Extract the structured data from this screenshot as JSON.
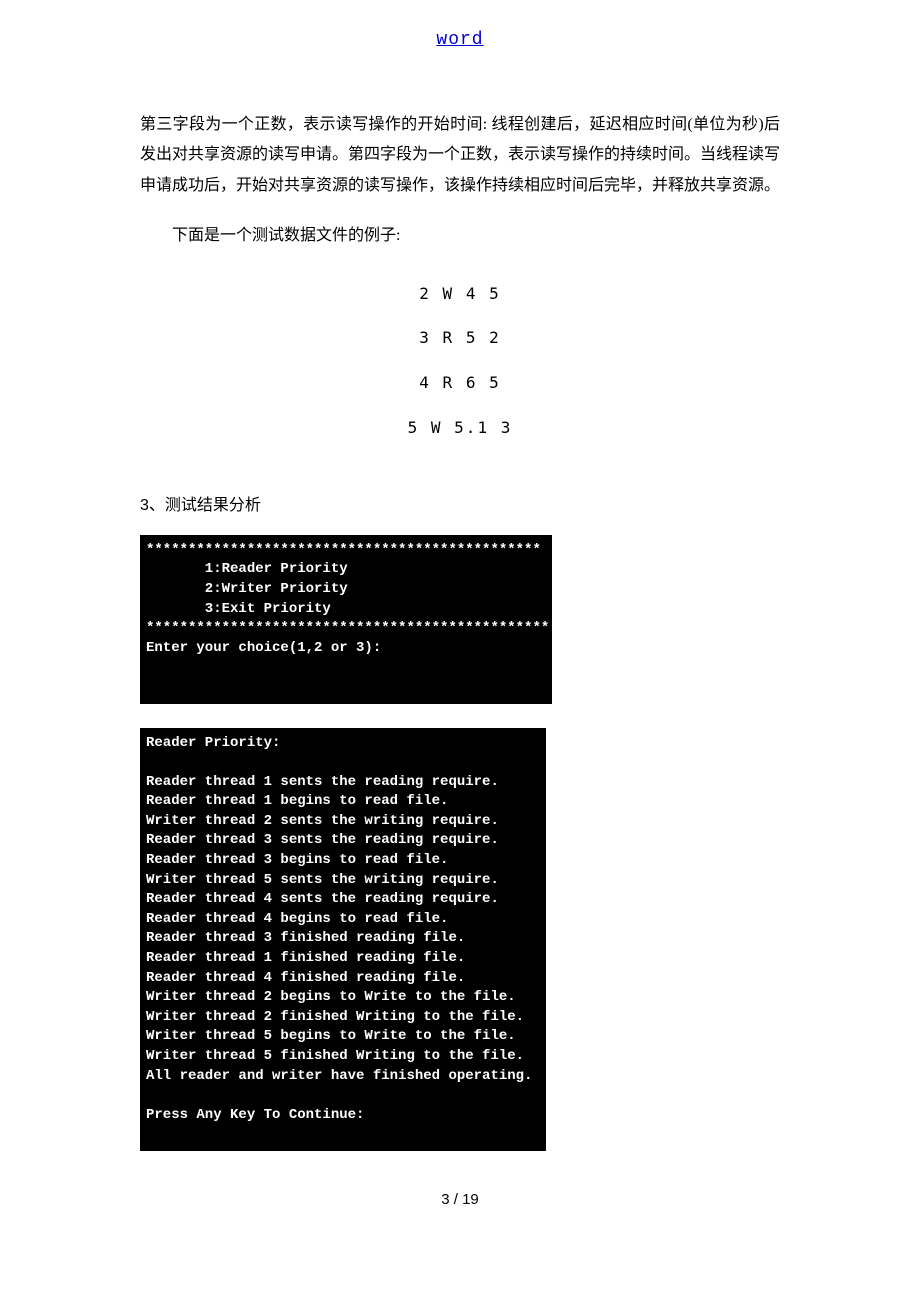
{
  "header": {
    "link": "word"
  },
  "para1": "第三字段为一个正数，表示读写操作的开始时间: 线程创建后，延迟相应时间(单位为秒)后发出对共享资源的读写申请。第四字段为一个正数，表示读写操作的持续时间。当线程读写申请成功后，开始对共享资源的读写操作，该操作持续相应时间后完毕，并释放共享资源。",
  "para2": "下面是一个测试数据文件的例子:",
  "test_data": [
    "2 W 4 5",
    "3 R 5 2",
    "4 R 6 5",
    "5 W 5.1 3"
  ],
  "section3_title": "3、测试结果分析",
  "terminal1": {
    "lines": [
      "***********************************************",
      "       1:Reader Priority",
      "       2:Writer Priority",
      "       3:Exit Priority",
      "************************************************",
      "Enter your choice(1,2 or 3):",
      "",
      "",
      ""
    ]
  },
  "terminal2": {
    "lines": [
      "Reader Priority:",
      "",
      "Reader thread 1 sents the reading require.",
      "Reader thread 1 begins to read file.",
      "Writer thread 2 sents the writing require.",
      "Reader thread 3 sents the reading require.",
      "Reader thread 3 begins to read file.",
      "Writer thread 5 sents the writing require.",
      "Reader thread 4 sents the reading require.",
      "Reader thread 4 begins to read file.",
      "Reader thread 3 finished reading file.",
      "Reader thread 1 finished reading file.",
      "Reader thread 4 finished reading file.",
      "Writer thread 2 begins to Write to the file.",
      "Writer thread 2 finished Writing to the file.",
      "Writer thread 5 begins to Write to the file.",
      "Writer thread 5 finished Writing to the file.",
      "All reader and writer have finished operating.",
      "",
      "Press Any Key To Continue:",
      "",
      ""
    ]
  },
  "footer": "3 / 19"
}
